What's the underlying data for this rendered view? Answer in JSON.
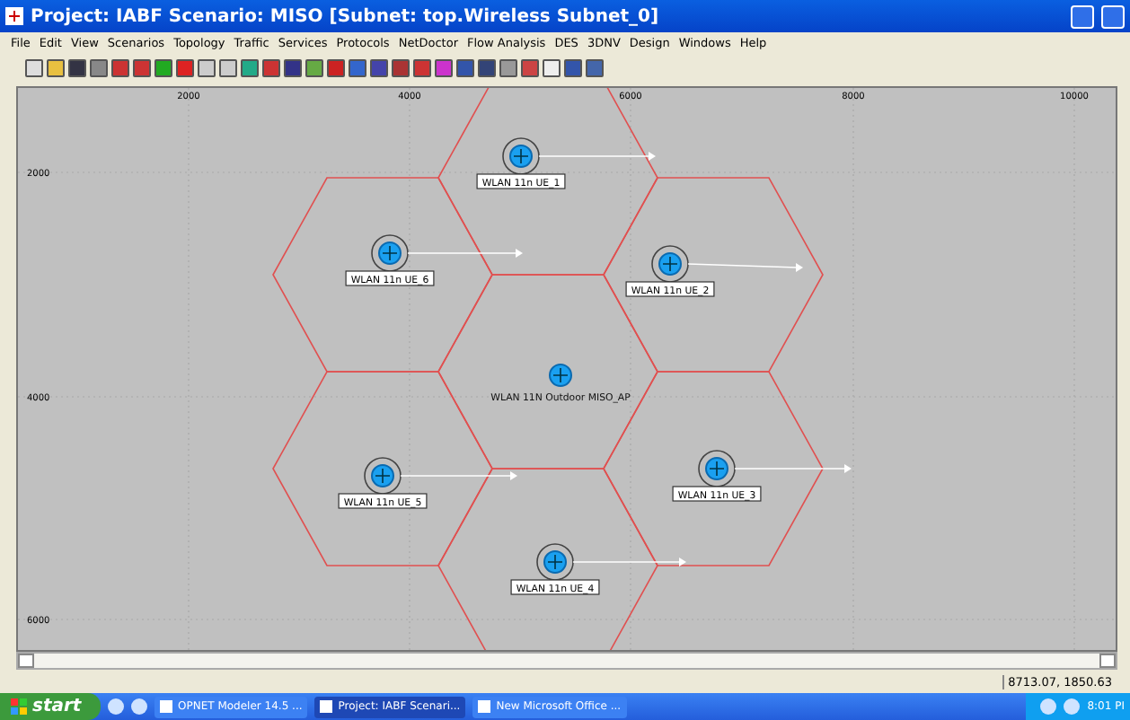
{
  "window": {
    "title": "Project: IABF Scenario: MISO  [Subnet: top.Wireless Subnet_0]"
  },
  "menu": [
    "File",
    "Edit",
    "View",
    "Scenarios",
    "Topology",
    "Traffic",
    "Services",
    "Protocols",
    "NetDoctor",
    "Flow Analysis",
    "DES",
    "3DNV",
    "Design",
    "Windows",
    "Help"
  ],
  "ruler": {
    "x_ticks": [
      {
        "label": "2000"
      },
      {
        "label": "4000"
      },
      {
        "label": "6000"
      },
      {
        "label": "8000"
      },
      {
        "label": "10000"
      }
    ],
    "y_ticks": [
      {
        "label": "2000"
      },
      {
        "label": "4000"
      },
      {
        "label": "6000"
      }
    ]
  },
  "nodes": [
    {
      "kind": "station",
      "label": "WLAN 11n UE_1"
    },
    {
      "kind": "station",
      "label": "WLAN 11n UE_6"
    },
    {
      "kind": "station",
      "label": "WLAN 11n UE_2"
    },
    {
      "kind": "access_point",
      "label": "WLAN 11N Outdoor MISO_AP"
    },
    {
      "kind": "station",
      "label": "WLAN 11n UE_5"
    },
    {
      "kind": "station",
      "label": "WLAN 11n UE_3"
    },
    {
      "kind": "station",
      "label": "WLAN 11n UE_4"
    }
  ],
  "status_bar": {
    "coordinates": "8713.07, 1850.63"
  },
  "taskbar": {
    "start": "start",
    "tasks": [
      {
        "label": "OPNET Modeler 14.5 ...",
        "selected": false
      },
      {
        "label": "Project: IABF Scenari...",
        "selected": true
      },
      {
        "label": "New Microsoft Office ...",
        "selected": false
      }
    ],
    "clock": "8:01 PI"
  }
}
